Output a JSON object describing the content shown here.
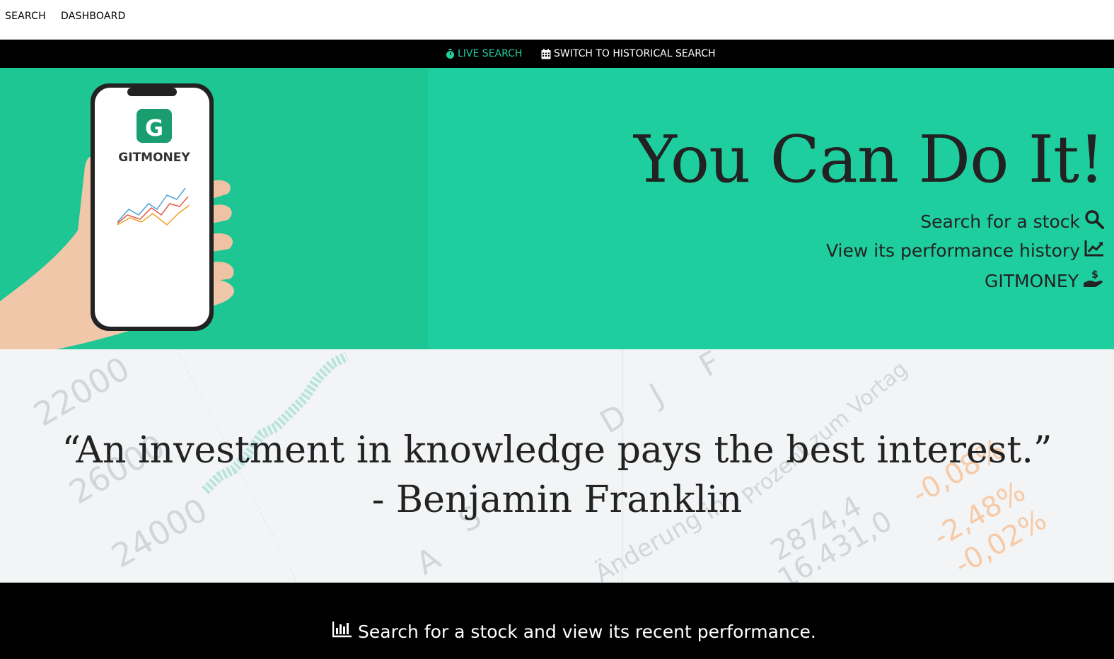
{
  "topnav": {
    "search_label": "SEARCH",
    "dashboard_label": "DASHBOARD"
  },
  "modebar": {
    "live_label": "LIVE SEARCH",
    "live_icon": "stopwatch-icon",
    "historical_label": "SWITCH TO HISTORICAL SEARCH",
    "historical_icon": "calendar-icon",
    "active_color": "#20cf9c"
  },
  "hero": {
    "phone_logo_text": "GITMONEY",
    "title": "You Can Do It!",
    "line1": "Search for a stock",
    "line1_icon": "search-icon",
    "line2": "View its performance history",
    "line2_icon": "chart-line-icon",
    "line3": "GITMONEY",
    "line3_icon": "hand-holding-dollar-icon",
    "bg_color": "#1fce9e"
  },
  "quote": {
    "line1": "“An investment in knowledge pays the best interest.”",
    "line2": "- Benjamin Franklin"
  },
  "footer": {
    "text": "Search for a stock and view its recent performance.",
    "icon": "bar-chart-icon"
  }
}
